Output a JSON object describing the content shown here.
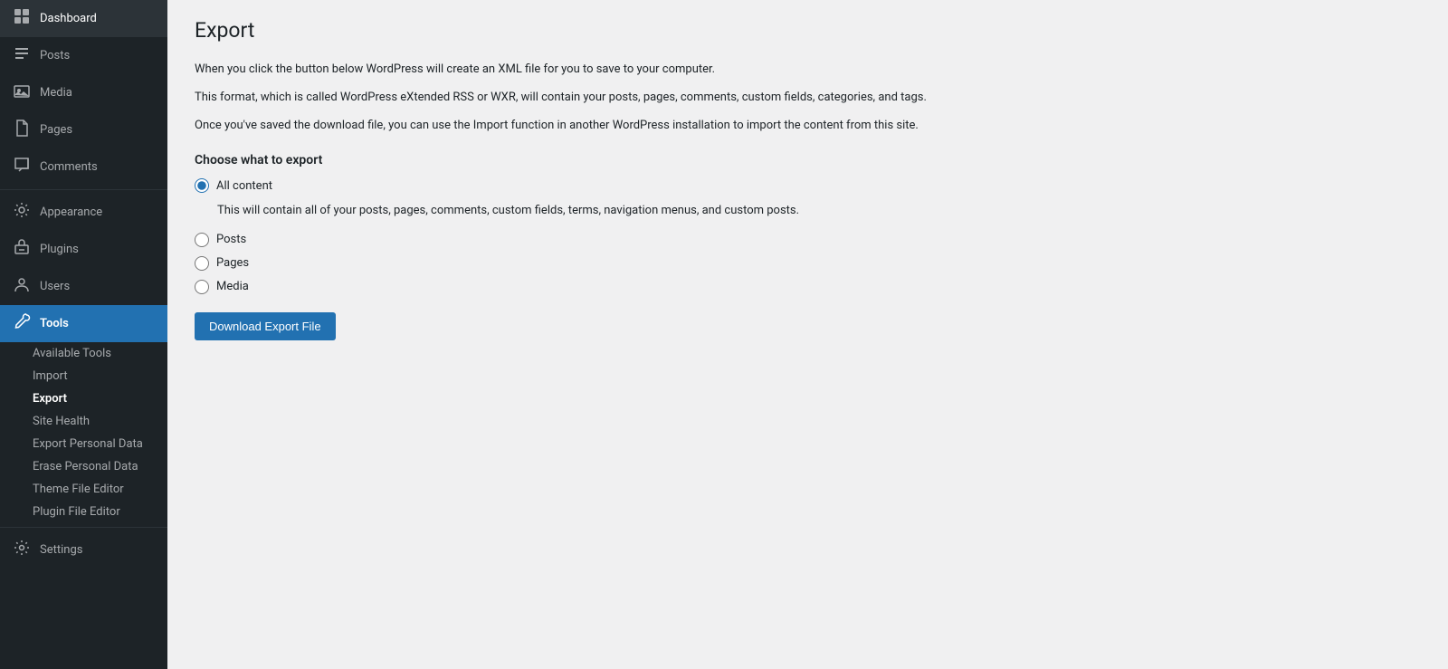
{
  "sidebar": {
    "items": [
      {
        "id": "dashboard",
        "label": "Dashboard",
        "icon": "⊞",
        "active": false
      },
      {
        "id": "posts",
        "label": "Posts",
        "icon": "✎",
        "active": false
      },
      {
        "id": "media",
        "label": "Media",
        "icon": "❑",
        "active": false
      },
      {
        "id": "pages",
        "label": "Pages",
        "icon": "📄",
        "active": false
      },
      {
        "id": "comments",
        "label": "Comments",
        "icon": "💬",
        "active": false
      },
      {
        "id": "appearance",
        "label": "Appearance",
        "icon": "🎨",
        "active": false
      },
      {
        "id": "plugins",
        "label": "Plugins",
        "icon": "🔌",
        "active": false
      },
      {
        "id": "users",
        "label": "Users",
        "icon": "👤",
        "active": false
      },
      {
        "id": "tools",
        "label": "Tools",
        "icon": "🔧",
        "active": true
      },
      {
        "id": "settings",
        "label": "Settings",
        "icon": "⊞",
        "active": false
      }
    ],
    "submenu": {
      "tools": [
        {
          "id": "available-tools",
          "label": "Available Tools",
          "active": false
        },
        {
          "id": "import",
          "label": "Import",
          "active": false
        },
        {
          "id": "export",
          "label": "Export",
          "active": true
        },
        {
          "id": "site-health",
          "label": "Site Health",
          "active": false
        },
        {
          "id": "export-personal-data",
          "label": "Export Personal Data",
          "active": false
        },
        {
          "id": "erase-personal-data",
          "label": "Erase Personal Data",
          "active": false
        },
        {
          "id": "theme-file-editor",
          "label": "Theme File Editor",
          "active": false
        },
        {
          "id": "plugin-file-editor",
          "label": "Plugin File Editor",
          "active": false
        }
      ]
    }
  },
  "main": {
    "title": "Export",
    "desc1": "When you click the button below WordPress will create an XML file for you to save to your computer.",
    "desc2": "This format, which is called WordPress eXtended RSS or WXR, will contain your posts, pages, comments, custom fields, categories, and tags.",
    "desc3": "Once you've saved the download file, you can use the Import function in another WordPress installation to import the content from this site.",
    "section_title": "Choose what to export",
    "options": [
      {
        "id": "all-content",
        "label": "All content",
        "checked": true
      },
      {
        "id": "posts",
        "label": "Posts",
        "checked": false
      },
      {
        "id": "pages",
        "label": "Pages",
        "checked": false
      },
      {
        "id": "media",
        "label": "Media",
        "checked": false
      }
    ],
    "all_content_desc": "This will contain all of your posts, pages, comments, custom fields, terms, navigation menus, and custom posts.",
    "button_label": "Download Export File"
  }
}
